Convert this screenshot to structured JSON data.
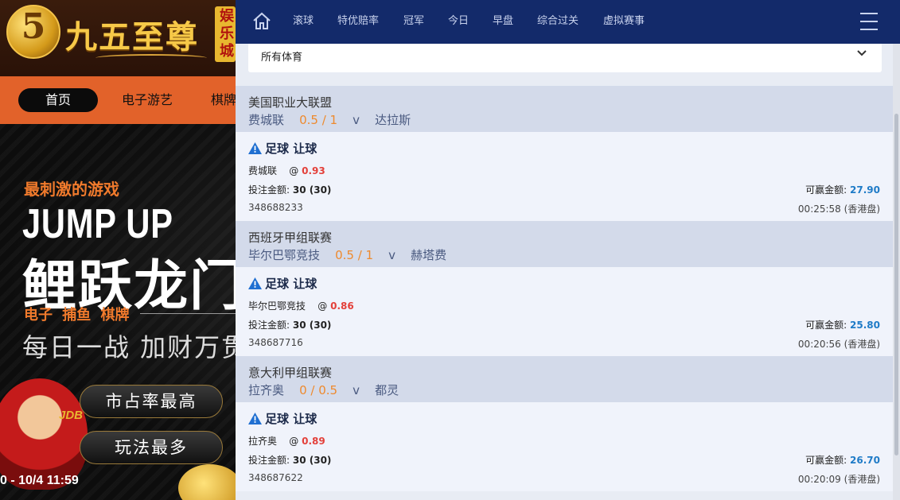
{
  "site": {
    "logo_glyph": "5",
    "logo_text": "九五至尊",
    "logo_tag": "娱乐城",
    "nav": [
      "首页",
      "电子游艺",
      "棋牌"
    ],
    "banner": {
      "slogan": "最刺激的游戏",
      "headline_en": "JUMP UP",
      "headline_cn": "鲤跃龙门",
      "categories": "电子 捕鱼 棋牌",
      "subline": "每日一战 加财万贯",
      "pill_1": "市占率最高",
      "pill_2": "玩法最多",
      "jdb": "JDB",
      "date": "0 - 10/4 11:59"
    }
  },
  "panel": {
    "tabs": [
      "滚球",
      "特优赔率",
      "冠军",
      "今日",
      "早盘",
      "综合过关",
      "虚拟赛事"
    ],
    "sport_filter": "所有体育",
    "labels": {
      "stake": "投注金额:",
      "win": "可赢金额:",
      "at": "@"
    },
    "bets": [
      {
        "league": "美国职业大联盟",
        "home": "费城联",
        "handicap": "0.5 / 1",
        "vs": "v",
        "away": "达拉斯",
        "bet_type": "足球 让球",
        "pick": "费城联",
        "odds": "0.93",
        "stake": "30 (30)",
        "win": "27.90",
        "ref": "348688233",
        "time": "00:25:58 (香港盘)"
      },
      {
        "league": "西班牙甲组联赛",
        "home": "毕尔巴鄂竞技",
        "handicap": "0.5 / 1",
        "vs": "v",
        "away": "赫塔费",
        "bet_type": "足球 让球",
        "pick": "毕尔巴鄂竞技",
        "odds": "0.86",
        "stake": "30 (30)",
        "win": "25.80",
        "ref": "348687716",
        "time": "00:20:56 (香港盘)"
      },
      {
        "league": "意大利甲组联赛",
        "home": "拉齐奥",
        "handicap": "0 / 0.5",
        "vs": "v",
        "away": "都灵",
        "bet_type": "足球 让球",
        "pick": "拉齐奥",
        "odds": "0.89",
        "stake": "30 (30)",
        "win": "26.70",
        "ref": "348687622",
        "time": "00:20:09 (香港盘)"
      }
    ]
  }
}
